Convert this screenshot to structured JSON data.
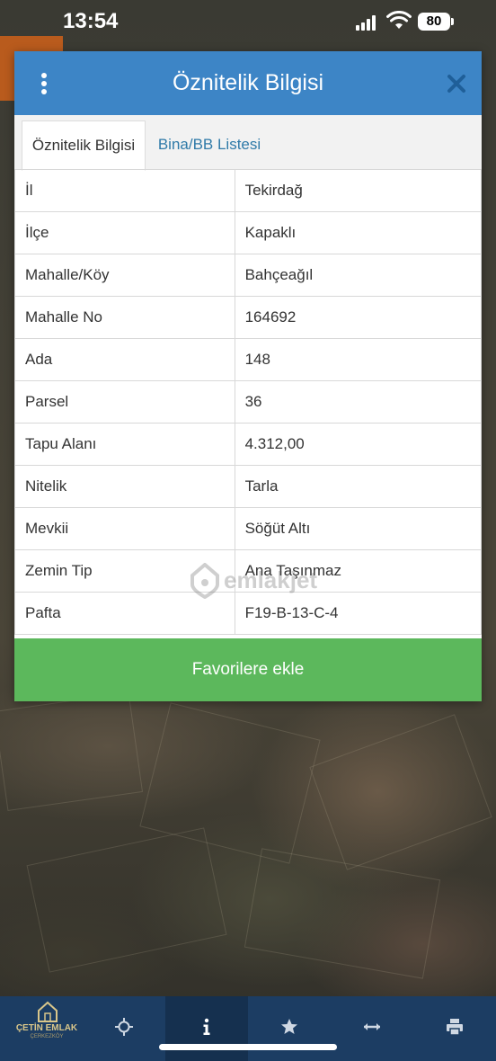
{
  "status_bar": {
    "time": "13:54",
    "battery": "80"
  },
  "dialog": {
    "title": "Öznitelik Bilgisi",
    "tabs": [
      {
        "label": "Öznitelik Bilgisi",
        "active": true
      },
      {
        "label": "Bina/BB Listesi",
        "active": false
      }
    ],
    "rows": [
      {
        "key": "İl",
        "value": "Tekirdağ"
      },
      {
        "key": "İlçe",
        "value": "Kapaklı"
      },
      {
        "key": "Mahalle/Köy",
        "value": "Bahçeağıl"
      },
      {
        "key": "Mahalle No",
        "value": "164692"
      },
      {
        "key": "Ada",
        "value": "148"
      },
      {
        "key": "Parsel",
        "value": "36"
      },
      {
        "key": "Tapu Alanı",
        "value": "4.312,00"
      },
      {
        "key": "Nitelik",
        "value": "Tarla"
      },
      {
        "key": "Mevkii",
        "value": "Söğüt Altı"
      },
      {
        "key": "Zemin Tip",
        "value": "Ana Taşınmaz"
      },
      {
        "key": "Pafta",
        "value": "F19-B-13-C-4"
      }
    ],
    "favorite_button": "Favorilere ekle"
  },
  "watermark": "emlakjet",
  "toolbar": {
    "logo_text": "ÇETİN EMLAK",
    "logo_sub": "ÇERKEZKÖY",
    "items": [
      "crosshair-icon",
      "info-icon",
      "star-icon",
      "measure-icon",
      "print-icon"
    ]
  },
  "colors": {
    "header": "#3d85c6",
    "favorite_button": "#5cb85c",
    "toolbar": "#1c3d63",
    "tab_link": "#2f7aa8"
  }
}
